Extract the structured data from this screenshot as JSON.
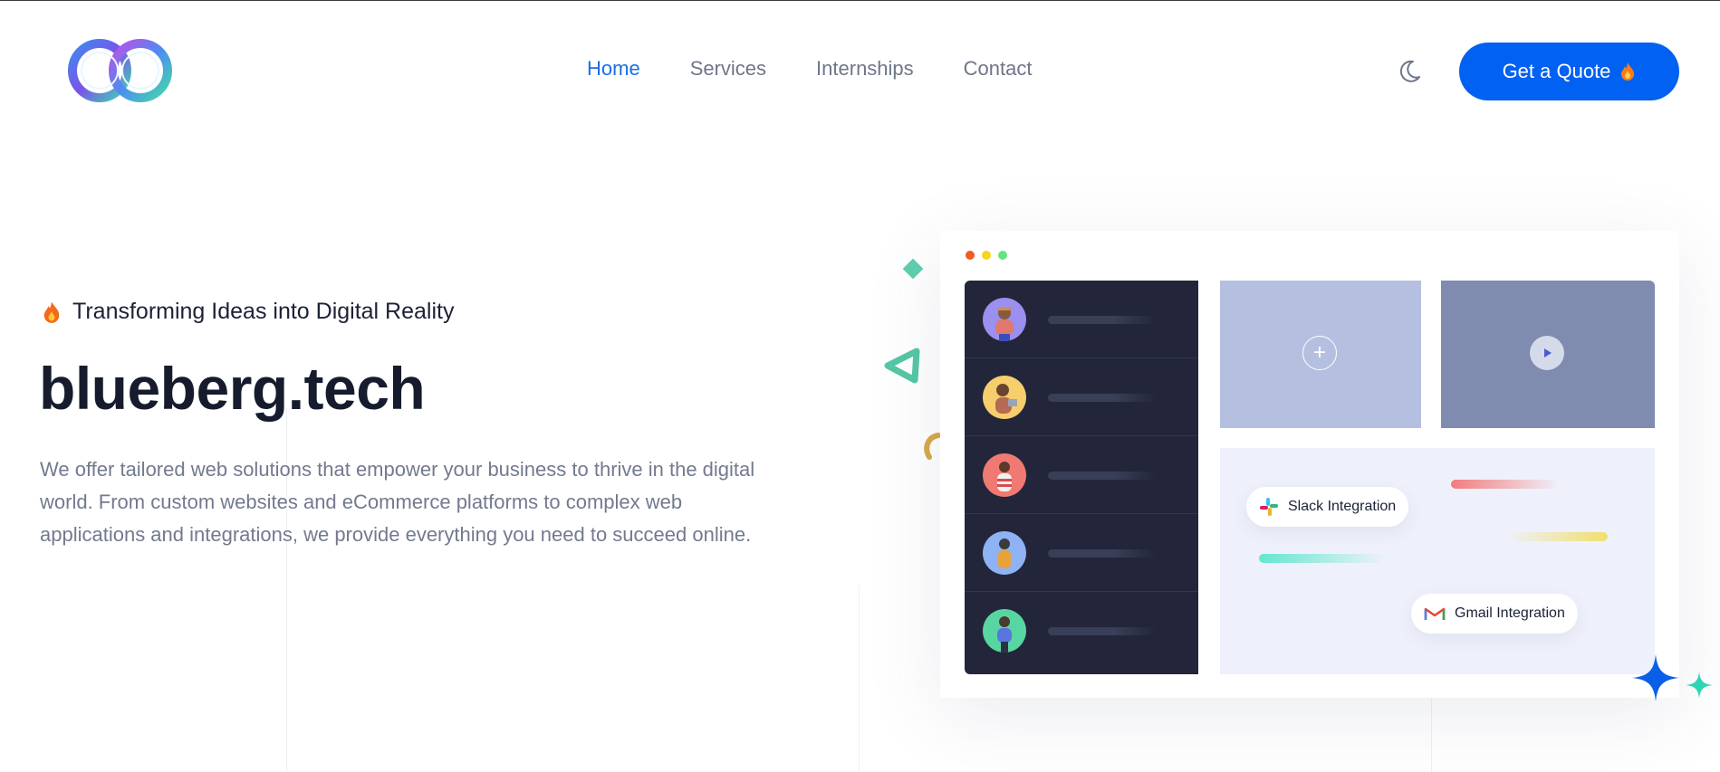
{
  "header": {
    "logo_alt": "logo",
    "nav": [
      {
        "label": "Home",
        "active": true
      },
      {
        "label": "Services",
        "active": false
      },
      {
        "label": "Internships",
        "active": false
      },
      {
        "label": "Contact",
        "active": false
      }
    ],
    "theme_toggle_icon": "moon-icon",
    "cta_label": "Get a Quote",
    "cta_icon": "fire-icon",
    "accent_color": "#0061f2"
  },
  "hero": {
    "tagline": "Transforming Ideas into Digital Reality",
    "tagline_icon": "fire-icon",
    "title": "blueberg.tech",
    "description": "We offer tailored web solutions that empower your business to thrive in the digital world. From custom websites and eCommerce platforms to complex web applications and integrations, we provide everything you need to succeed online."
  },
  "mockup": {
    "window_dots": [
      "#f15a22",
      "#f9d423",
      "#67e27e"
    ],
    "rows": 5,
    "integrations": [
      {
        "label": "Slack Integration",
        "icon": "slack-icon"
      },
      {
        "label": "Gmail Integration",
        "icon": "gmail-icon"
      }
    ],
    "buttons": {
      "add_icon": "plus-icon",
      "play_icon": "play-icon"
    }
  }
}
